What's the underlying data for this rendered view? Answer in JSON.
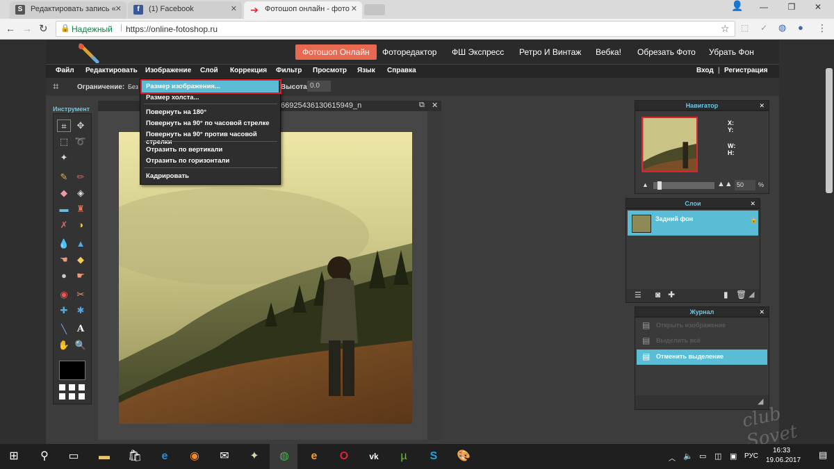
{
  "browser": {
    "tabs": [
      {
        "label": "Редактировать запись «",
        "favicon": "S"
      },
      {
        "label": "(1) Facebook",
        "favicon": "f"
      },
      {
        "label": "Фотошоп онлайн - фото",
        "favicon": "➔"
      }
    ],
    "secure_label": "Надежный",
    "url": "https://online-fotoshop.ru"
  },
  "site": {
    "nav": [
      "Фотошоп Онлайн",
      "Фоторедактор",
      "ФШ Экспресс",
      "Ретро И Винтаж",
      "Вебка!",
      "Обрезать Фото",
      "Убрать Фон"
    ],
    "menu": [
      "Файл",
      "Редактировать",
      "Изображение",
      "Слой",
      "Коррекция",
      "Фильтр",
      "Просмотр",
      "Язык",
      "Справка"
    ],
    "login": "Вход",
    "register": "Регистрация",
    "options": {
      "constraint_label": "Ограничение:",
      "constraint_value": "Без",
      "height_label": "Высота:",
      "height_value": "0.0"
    }
  },
  "dropdown": {
    "items": [
      "Размер изображения...",
      "Размер холста...",
      "Повернуть на 180°",
      "Повернуть на 90° по часовой стрелке",
      "Повернуть на 90° против часовой стрелки",
      "Отразить по вертикали",
      "Отразить по горизонтали",
      "Кадрировать"
    ]
  },
  "tools_title": "Инструмент",
  "document": {
    "title_visible": "66925436130615949_n"
  },
  "navigator": {
    "title": "Навигатор",
    "x": "X:",
    "y": "Y:",
    "w": "W:",
    "h": "H:",
    "zoom": "50",
    "pct": "%"
  },
  "layers": {
    "title": "Слои",
    "layer_name": "Задний фон"
  },
  "history": {
    "title": "Журнал",
    "items": [
      "Открыть изображение",
      "Выделить всё",
      "Отменить выделение"
    ]
  },
  "taskbar": {
    "lang": "РУС",
    "time": "16:33",
    "date": "19.06.2017"
  },
  "watermark": "club Sovet",
  "colors": {
    "accent": "#e8694f",
    "highlight": "#5bbcd6",
    "panel_title": "#6fc6e0"
  }
}
